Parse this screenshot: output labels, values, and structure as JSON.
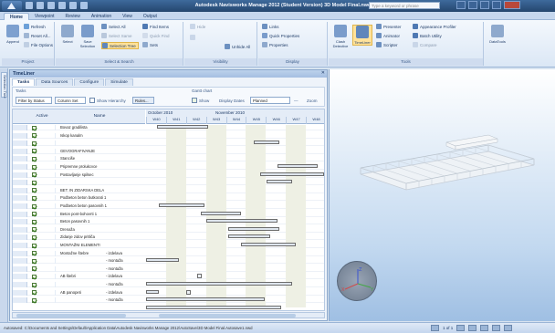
{
  "window": {
    "title": "Autodesk Navisworks Manage 2012 (Student Version)   3D Model Final.nwd",
    "help_placeholder": "Type a keyword or phrase"
  },
  "ribbon_tabs": [
    "Home",
    "Viewpoint",
    "Review",
    "Animation",
    "View",
    "Output"
  ],
  "ribbon": {
    "project": {
      "label": "Project",
      "append": "Append",
      "refresh": "Refresh",
      "reset_all": "Reset All...",
      "file_options": "File Options"
    },
    "select_search": {
      "label": "Select & Search",
      "select": "Select",
      "save_selection": "Save Selection",
      "select_all": "Select All",
      "select_same": "Select Same",
      "selection_tree": "Selection Tree",
      "find_items": "Find Items",
      "quick_find": "Quick Find",
      "sets": "Sets"
    },
    "visibility": {
      "label": "Visibility",
      "hide": "Hide",
      "unhide_all": "Unhide All"
    },
    "display": {
      "label": "Display",
      "links": "Links",
      "quick_properties": "Quick Properties",
      "properties": "Properties"
    },
    "tools": {
      "label": "Tools",
      "clash_detective": "Clash Detective",
      "timeliner": "TimeLiner",
      "presenter": "Presenter",
      "animator": "Animator",
      "scripter": "Scripter",
      "appearance_profiler": "Appearance Profiler",
      "batch_utility": "Batch Utility",
      "compare": "Compare",
      "datatools": "DataTools"
    }
  },
  "left_strip": {
    "tab": "Selection Tree"
  },
  "timeliner": {
    "title": "TimeLiner",
    "tabs": [
      "Tasks",
      "Data Sources",
      "Configure",
      "Simulate"
    ],
    "tasks_label": "Tasks",
    "filter_status": "Filter by Status",
    "column_set": "Column Set",
    "show_hierarchy": "Show Hierarchy",
    "rules": "Rules...",
    "gantt_label": "Gantt chart",
    "show": "Show",
    "display_dates": "Display Dates",
    "dates_value": "Planned",
    "zoom": "Zoom",
    "col_active": "Active",
    "col_name": "Name",
    "months": [
      "October 2010",
      "November 2010"
    ],
    "weeks": [
      "W40",
      "W41",
      "W42",
      "W43",
      "W44",
      "W45",
      "W46",
      "W47",
      "W48"
    ],
    "rows": [
      {
        "name": "Bovaz gradilista",
        "stage": ""
      },
      {
        "name": "Iskop kanalm",
        "stage": ""
      },
      {
        "name": "",
        "stage": ""
      },
      {
        "name": "GEVOGRAFIVANJE",
        "stage": ""
      },
      {
        "name": "Stanciše",
        "stage": ""
      },
      {
        "name": "Pripremne prolukcvce",
        "stage": ""
      },
      {
        "name": "Postavljanje spilsec",
        "stage": ""
      },
      {
        "name": "",
        "stage": ""
      },
      {
        "name": "BET. IN ZIDARSKA DELA",
        "stage": ""
      },
      {
        "name": "Podbeton beton butkorati 1",
        "stage": ""
      },
      {
        "name": "Podbeton beton pasovnih 1",
        "stage": ""
      },
      {
        "name": "Beton pont-bohovrti 1",
        "stage": ""
      },
      {
        "name": "Beton pasovnih 1",
        "stage": ""
      },
      {
        "name": "Drenaža",
        "stage": ""
      },
      {
        "name": "Zidanje zidov pritliča",
        "stage": ""
      },
      {
        "name": "MONTAŽNI ELEMENTI",
        "stage": ""
      },
      {
        "name": "Montažne štebre",
        "stage": "- izdelava"
      },
      {
        "name": "",
        "stage": "- montaža"
      },
      {
        "name": "",
        "stage": "- montaža"
      },
      {
        "name": "AB štebri",
        "stage": "- izdelava"
      },
      {
        "name": "",
        "stage": "- montaža"
      },
      {
        "name": "AB panopeti",
        "stage": "- izdelava"
      },
      {
        "name": "",
        "stage": "- montaža"
      }
    ]
  },
  "status": {
    "path": "Autosaved: C:\\Documents and Settings\\Default\\Application Data\\Autodesk Navisworks Manage 2012\\AutoSave\\3D Model Final.Autosave1.nwd",
    "page": "1 of 1"
  },
  "colors": {
    "accent": "#2b5387",
    "bar_fill": "#dfe6ee",
    "bar_border": "#6d6d6d",
    "check": "#3a7a22"
  }
}
